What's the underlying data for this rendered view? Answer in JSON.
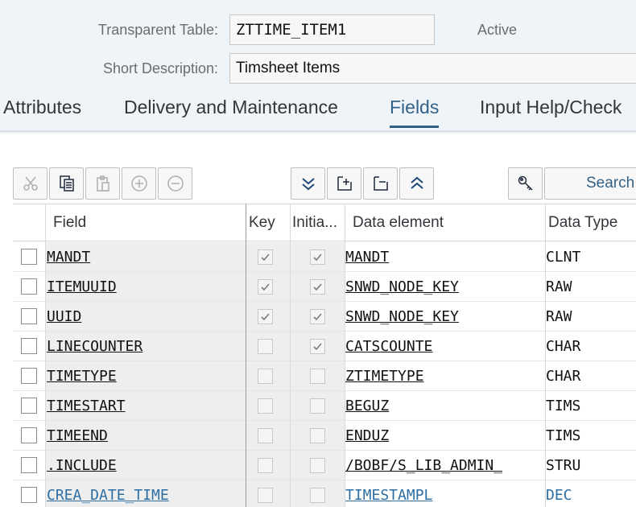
{
  "header": {
    "table_label": "Transparent Table:",
    "table_value": "ZTTIME_ITEM1",
    "status": "Active",
    "desc_label": "Short Description:",
    "desc_value": "Timsheet Items"
  },
  "tabs": [
    {
      "label": "Attributes",
      "active": false
    },
    {
      "label": "Delivery and Maintenance",
      "active": false
    },
    {
      "label": "Fields",
      "active": true
    },
    {
      "label": "Input Help/Check",
      "active": false
    }
  ],
  "toolbar": {
    "buttons": [
      "cut-icon",
      "copy-icon",
      "paste-icon",
      "insert-row-icon",
      "delete-row-icon",
      "collapse-all-icon",
      "insert-field-icon",
      "delete-field-icon",
      "expand-all-icon",
      "key-icon"
    ],
    "search_label": "Search"
  },
  "table": {
    "columns": [
      "Field",
      "Key",
      "Initia...",
      "Data element",
      "Data Type"
    ],
    "rows": [
      {
        "field": "MANDT",
        "key": true,
        "initial": true,
        "data_element": "MANDT",
        "data_type": "CLNT",
        "highlight": false
      },
      {
        "field": "ITEMUUID",
        "key": true,
        "initial": true,
        "data_element": "SNWD_NODE_KEY",
        "data_type": "RAW",
        "highlight": false
      },
      {
        "field": "UUID",
        "key": true,
        "initial": true,
        "data_element": "SNWD_NODE_KEY",
        "data_type": "RAW",
        "highlight": false
      },
      {
        "field": "LINECOUNTER",
        "key": false,
        "initial": true,
        "data_element": "CATSCOUNTE",
        "data_type": "CHAR",
        "highlight": false
      },
      {
        "field": "TIMETYPE",
        "key": false,
        "initial": false,
        "data_element": "ZTIMETYPE",
        "data_type": "CHAR",
        "highlight": false
      },
      {
        "field": "TIMESTART",
        "key": false,
        "initial": false,
        "data_element": "BEGUZ",
        "data_type": "TIMS",
        "highlight": false
      },
      {
        "field": "TIMEEND",
        "key": false,
        "initial": false,
        "data_element": "ENDUZ",
        "data_type": "TIMS",
        "highlight": false
      },
      {
        "field": ".INCLUDE",
        "key": false,
        "initial": false,
        "data_element": "/BOBF/S_LIB_ADMIN_",
        "data_type": "STRU",
        "highlight": false
      },
      {
        "field": "CREA_DATE_TIME",
        "key": false,
        "initial": false,
        "data_element": "TIMESTAMPL",
        "data_type": "DEC",
        "highlight": true
      }
    ]
  },
  "colors": {
    "accent": "#346187",
    "link_blue": "#2c6ea3",
    "background": "#eff4f9"
  }
}
